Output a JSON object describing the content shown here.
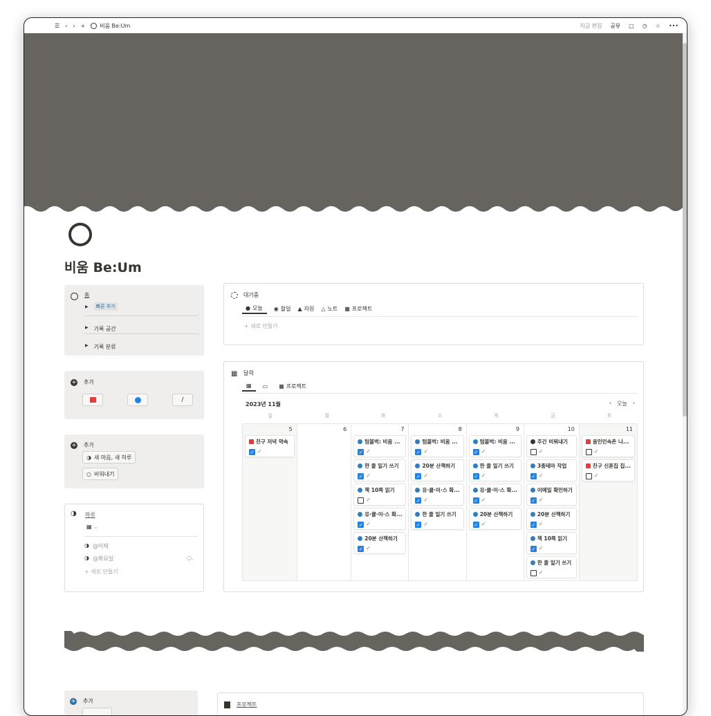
{
  "topbar": {
    "title": "비움 Be:Um",
    "edited": "지금 편집",
    "share": "공유"
  },
  "page": {
    "title": "비움 Be:Um"
  },
  "home": {
    "title": "홈",
    "items": [
      "빠른 추가",
      "기록 공간",
      "기록 분류"
    ]
  },
  "add1": {
    "title": "추가"
  },
  "add2": {
    "title": "추가",
    "buttons": [
      "새 마음, 새 하루",
      "비워내기"
    ]
  },
  "day": {
    "title": "하루",
    "rows": [
      "@어제",
      "@화요일"
    ],
    "new": "새로 만들기"
  },
  "waiting": {
    "title": "대기중",
    "tabs": [
      "오늘",
      "할일",
      "자원",
      "노트",
      "프로젝트"
    ],
    "new": "새로 만들기"
  },
  "calendar": {
    "title": "달력",
    "tabs": [
      "",
      "",
      "프로젝트"
    ],
    "month": "2023년 11월",
    "today": "오늘",
    "weekdays": [
      "일",
      "월",
      "화",
      "수",
      "목",
      "금",
      "토"
    ],
    "days": [
      {
        "num": "5",
        "cards": [
          {
            "t": "친구 저녁 약속",
            "k": "event",
            "c": true
          }
        ]
      },
      {
        "num": "6",
        "cards": []
      },
      {
        "num": "7",
        "cards": [
          {
            "t": "텀블벅: 비움 ...",
            "k": "task",
            "c": true
          },
          {
            "t": "한 줄 일기 쓰기",
            "k": "task",
            "c": true
          },
          {
            "t": "책 10쪽 읽기",
            "k": "task",
            "c": false
          },
          {
            "t": "유·큘·이·스 확...",
            "k": "task",
            "c": true
          },
          {
            "t": "20분 산책하기",
            "k": "task",
            "c": true
          }
        ]
      },
      {
        "num": "8",
        "cards": [
          {
            "t": "텀블벅: 비움 ...",
            "k": "task",
            "c": true
          },
          {
            "t": "20분 산책하기",
            "k": "task",
            "c": true
          },
          {
            "t": "유·큘·이·스 확...",
            "k": "task",
            "c": true
          },
          {
            "t": "한 줄 일기 쓰기",
            "k": "task",
            "c": true
          }
        ]
      },
      {
        "num": "9",
        "cards": [
          {
            "t": "텀블벅: 비움 ...",
            "k": "task",
            "c": true
          },
          {
            "t": "한 줄 일기 쓰기",
            "k": "task",
            "c": true
          },
          {
            "t": "유·큘·이·스 확...",
            "k": "task",
            "c": true
          },
          {
            "t": "20분 산책하기",
            "k": "task",
            "c": true
          }
        ]
      },
      {
        "num": "10",
        "cards": [
          {
            "t": "주간 비워내기",
            "k": "dark",
            "c": false
          },
          {
            "t": "3종테마 작업",
            "k": "task",
            "c": true
          },
          {
            "t": "이메일 확인하기",
            "k": "task",
            "c": true
          },
          {
            "t": "20분 산책하기",
            "k": "task",
            "c": true
          },
          {
            "t": "책 10쪽 읽기",
            "k": "task",
            "c": true
          },
          {
            "t": "한 줄 일기 쓰기",
            "k": "task",
            "c": false
          }
        ]
      },
      {
        "num": "11",
        "cards": [
          {
            "t": "용인민속촌 나...",
            "k": "event",
            "c": false
          },
          {
            "t": "친구 신혼집 집...",
            "k": "event",
            "c": false
          }
        ]
      }
    ]
  },
  "bottom": {
    "add": "추가",
    "project": "프로젝트"
  },
  "colors": {
    "cover": "#67645f",
    "accent": "#2383e2",
    "event": "#e03e3e"
  }
}
